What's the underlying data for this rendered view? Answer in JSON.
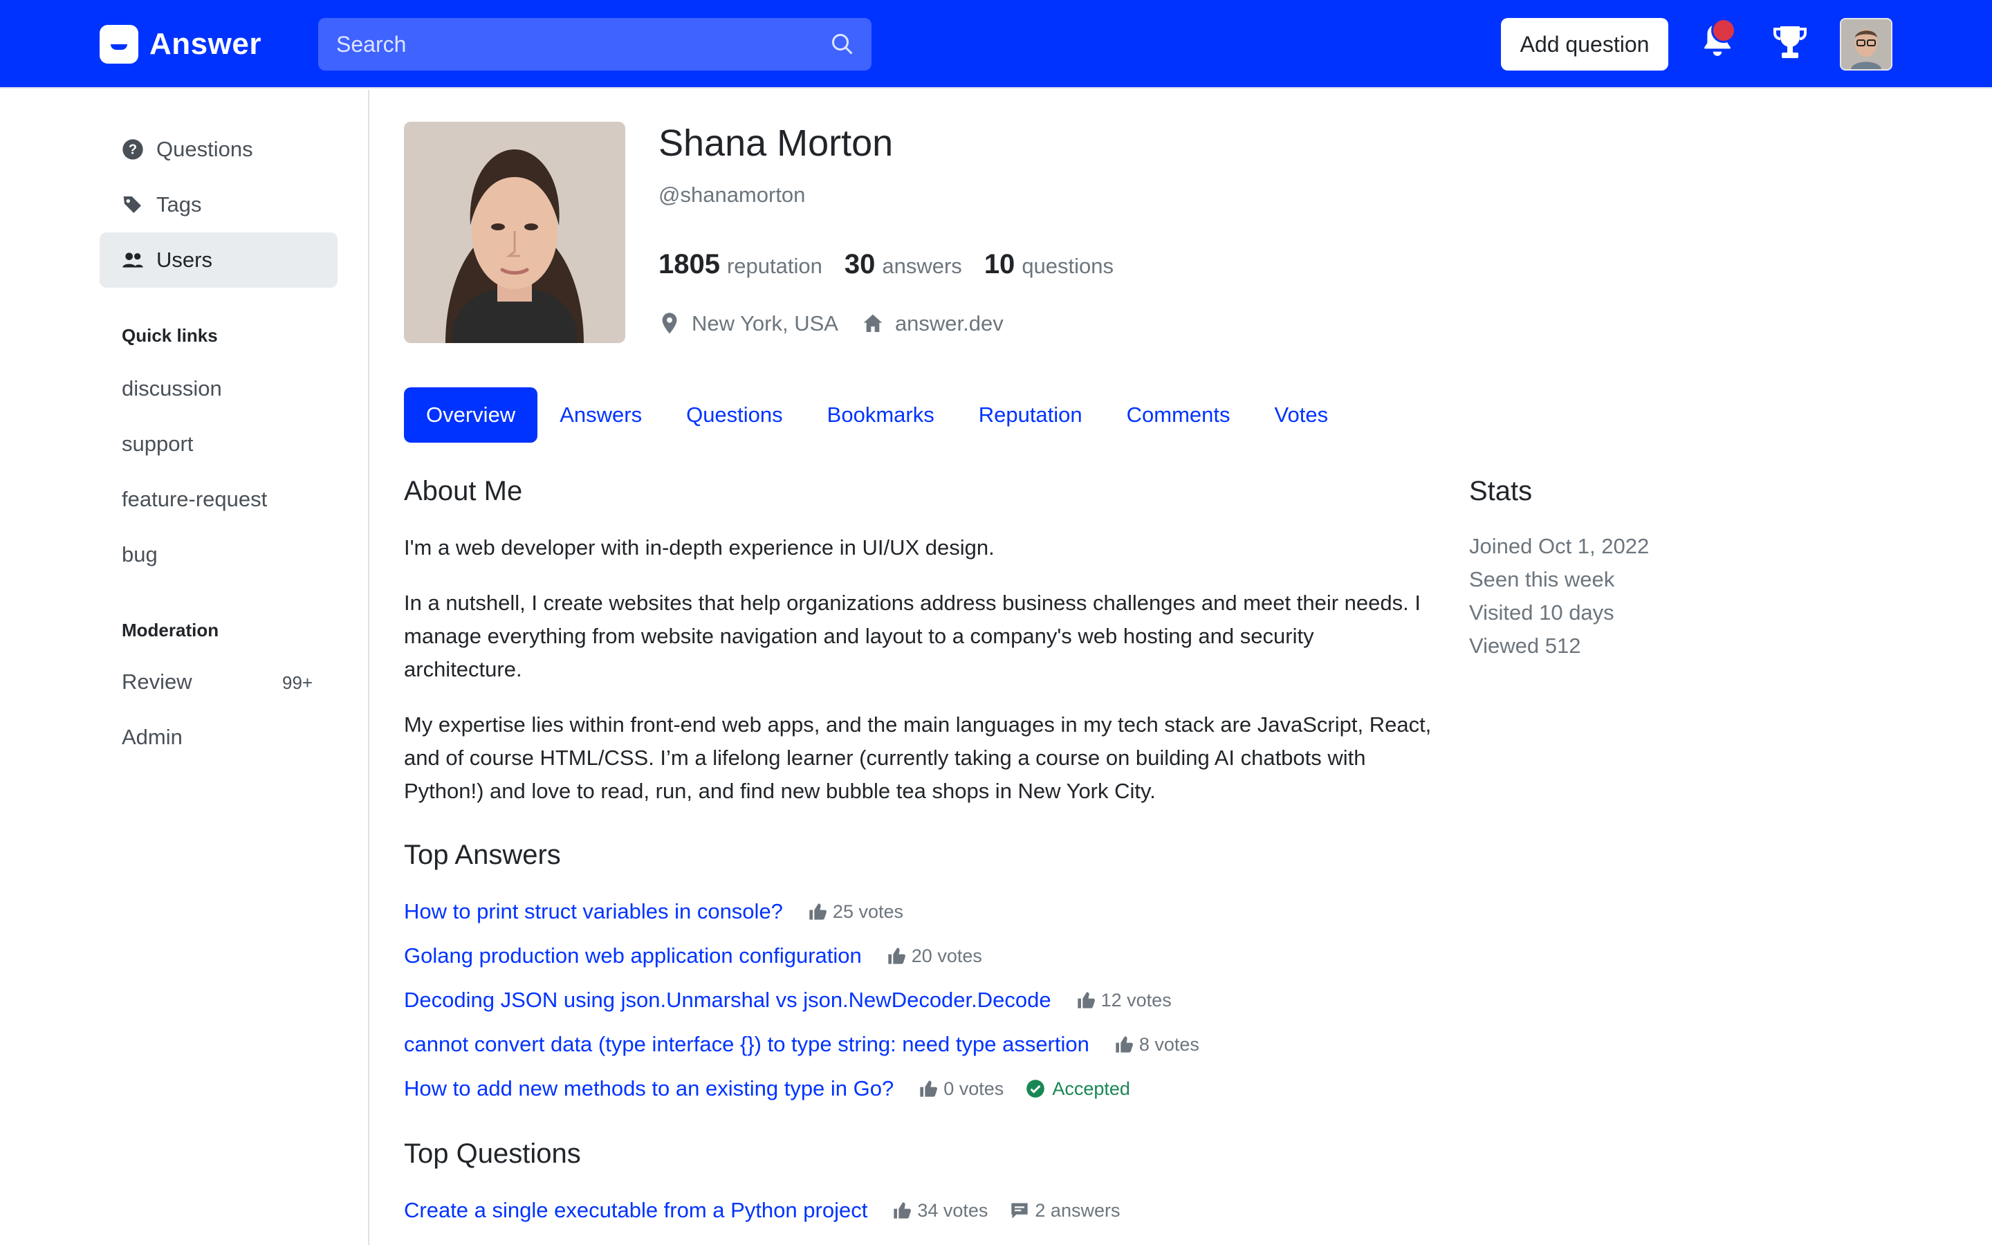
{
  "header": {
    "logo": "Answer",
    "search_placeholder": "Search",
    "add_question": "Add question",
    "colors": {
      "brand": "#0033ff",
      "notification": "#dc3545"
    }
  },
  "sidebar": {
    "nav": [
      {
        "label": "Questions",
        "icon": "question-circle-icon"
      },
      {
        "label": "Tags",
        "icon": "tags-icon"
      },
      {
        "label": "Users",
        "icon": "people-icon",
        "active": true
      }
    ],
    "quick_links_heading": "Quick links",
    "quick_links": [
      "discussion",
      "support",
      "feature-request",
      "bug"
    ],
    "moderation_heading": "Moderation",
    "moderation": [
      {
        "label": "Review",
        "count": "99+"
      },
      {
        "label": "Admin"
      }
    ]
  },
  "profile": {
    "name": "Shana Morton",
    "handle": "@shanamorton",
    "reputation": "1805",
    "reputation_label": "reputation",
    "answers": "30",
    "answers_label": "answers",
    "questions": "10",
    "questions_label": "questions",
    "location": "New York, USA",
    "website": "answer.dev"
  },
  "tabs": [
    "Overview",
    "Answers",
    "Questions",
    "Bookmarks",
    "Reputation",
    "Comments",
    "Votes"
  ],
  "about": {
    "title": "About Me",
    "paragraphs": [
      "I'm a web developer with in-depth experience in UI/UX design.",
      "In a nutshell, I create websites that help organizations address business challenges and meet their needs. I manage everything from website navigation and layout to a company's web hosting and security architecture.",
      "My expertise lies within front-end web apps, and the main languages in my tech stack are JavaScript, React, and of course HTML/CSS. I’m a lifelong learner (currently taking a course on building AI chatbots with Python!) and love to read, run, and find new bubble tea shops in New York City."
    ]
  },
  "top_answers": {
    "title": "Top Answers",
    "items": [
      {
        "title": "How to print struct variables in console?",
        "votes": "25 votes"
      },
      {
        "title": "Golang production web application configuration",
        "votes": "20 votes"
      },
      {
        "title": "Decoding JSON using json.Unmarshal vs json.NewDecoder.Decode",
        "votes": "12 votes"
      },
      {
        "title": "cannot convert data (type interface {}) to type string: need type assertion",
        "votes": "8 votes"
      },
      {
        "title": "How to add new methods to an existing type in Go?",
        "votes": "0 votes",
        "accepted": "Accepted"
      }
    ]
  },
  "top_questions": {
    "title": "Top Questions",
    "items": [
      {
        "title": "Create a single executable from a Python project",
        "votes": "34 votes",
        "answers": "2 answers"
      }
    ]
  },
  "stats": {
    "title": "Stats",
    "lines": [
      "Joined Oct 1, 2022",
      "Seen this week",
      "Visited 10 days",
      "Viewed 512"
    ]
  }
}
